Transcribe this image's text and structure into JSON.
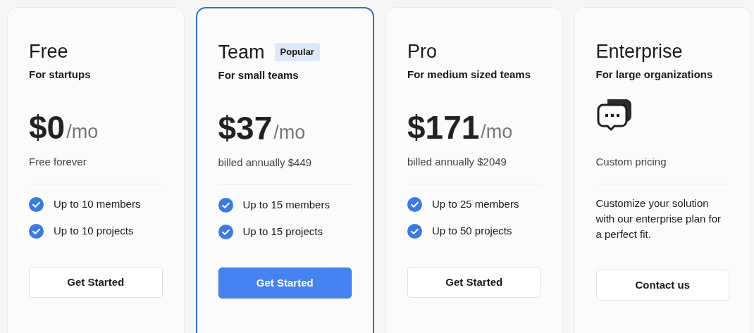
{
  "plans": [
    {
      "kind": "price",
      "highlighted": false,
      "name": "Free",
      "subtitle": "For startups",
      "price": "$0",
      "period": "/mo",
      "note": "Free forever",
      "features": [
        "Up to 10 members",
        "Up to 10 projects"
      ],
      "button": {
        "label": "Get Started",
        "primary": false
      }
    },
    {
      "kind": "price",
      "highlighted": true,
      "name": "Team",
      "badge": "Popular",
      "subtitle": "For small teams",
      "price": "$37",
      "period": "/mo",
      "note": "billed annually $449",
      "features": [
        "Up to 15 members",
        "Up to 15 projects"
      ],
      "button": {
        "label": "Get Started",
        "primary": true
      }
    },
    {
      "kind": "price",
      "highlighted": false,
      "name": "Pro",
      "subtitle": "For medium sized teams",
      "price": "$171",
      "period": "/mo",
      "note": "billed annually $2049",
      "features": [
        "Up to 25 members",
        "Up to 50 projects"
      ],
      "button": {
        "label": "Get Started",
        "primary": false
      }
    },
    {
      "kind": "custom",
      "highlighted": false,
      "name": "Enterprise",
      "subtitle": "For large organizations",
      "note": "Custom pricing",
      "description": "Customize your solution with our enterprise plan for a perfect fit.",
      "button": {
        "label": "Contact us",
        "primary": false
      }
    }
  ]
}
